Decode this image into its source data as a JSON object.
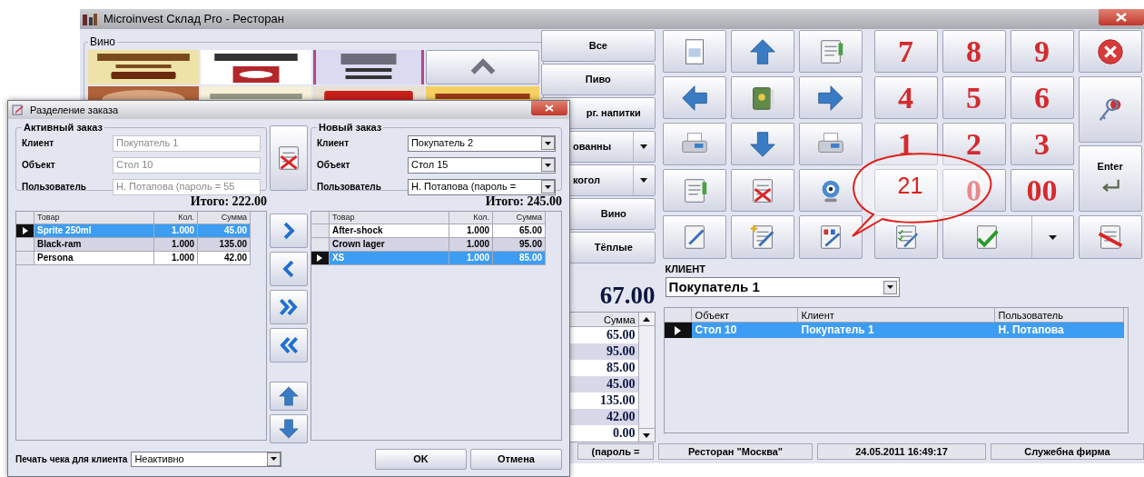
{
  "window": {
    "title": "Microinvest Склад Pro - Ресторан"
  },
  "wine_group": {
    "title": "Вино"
  },
  "categories": [
    {
      "label": "Все",
      "dropdown": false
    },
    {
      "label": "Пиво",
      "dropdown": false
    },
    {
      "label": "рг. напитки",
      "dropdown": false
    },
    {
      "label": "ованны",
      "dropdown": true
    },
    {
      "label": "когол",
      "dropdown": true
    },
    {
      "label": "Вино",
      "dropdown": false
    },
    {
      "label": "Тёплые",
      "dropdown": false
    }
  ],
  "order_total": "67.00",
  "sums": {
    "header": "Сумма",
    "values": [
      "65.00",
      "95.00",
      "85.00",
      "45.00",
      "135.00",
      "42.00",
      "0.00"
    ]
  },
  "keypad": {
    "digits": [
      "7",
      "8",
      "9",
      "4",
      "5",
      "6",
      "1",
      "2",
      "3",
      "0",
      "00"
    ],
    "enter": "Enter"
  },
  "callout": {
    "text": "21"
  },
  "client": {
    "label": "КЛИЕНТ",
    "value": "Покупатель 1"
  },
  "orders_table": {
    "columns": [
      "Объект",
      "Клиент",
      "Пользователь"
    ],
    "rows": [
      {
        "cells": [
          "Стол 10",
          "Покупатель 1",
          "Н. Потапова"
        ],
        "selected": true
      }
    ]
  },
  "status_bar": [
    "(пароль =",
    "Ресторан \"Москва\"",
    "24.05.2011 16:49:17",
    "Служебна фирма"
  ],
  "dialog": {
    "title": "Разделение заказа",
    "active_order": {
      "title": "Активный заказ",
      "fields": [
        {
          "label": "Клиент",
          "value": "Покупатель 1",
          "disabled": true
        },
        {
          "label": "Объект",
          "value": "Стол 10",
          "disabled": true
        },
        {
          "label": "Пользователь",
          "value": "Н. Потапова  (пароль = 55",
          "disabled": true
        }
      ],
      "total": "Итого: 222.00",
      "grid": {
        "columns": [
          "Товар",
          "Кол.",
          "Сумма"
        ],
        "rows": [
          {
            "cells": [
              "Sprite 250ml",
              "1.000",
              "45.00"
            ],
            "selected": true
          },
          {
            "cells": [
              "Black-ram",
              "1.000",
              "135.00"
            ],
            "selected": false
          },
          {
            "cells": [
              "Persona",
              "1.000",
              "42.00"
            ],
            "selected": false
          }
        ]
      }
    },
    "new_order": {
      "title": "Новый заказ",
      "fields": [
        {
          "label": "Клиент",
          "value": "Покупатель 2",
          "disabled": false
        },
        {
          "label": "Объект",
          "value": "Стол 15",
          "disabled": false
        },
        {
          "label": "Пользователь",
          "value": "Н. Потапова  (пароль =",
          "disabled": false
        }
      ],
      "total": "Итого: 245.00",
      "grid": {
        "columns": [
          "Товар",
          "Кол.",
          "Сумма"
        ],
        "rows": [
          {
            "cells": [
              "After-shock",
              "1.000",
              "65.00"
            ],
            "selected": false
          },
          {
            "cells": [
              "Crown lager",
              "1.000",
              "95.00"
            ],
            "selected": false
          },
          {
            "cells": [
              "XS",
              "1.000",
              "85.00"
            ],
            "selected": true
          }
        ]
      }
    },
    "print_label": "Печать чека для клиента",
    "print_value": "Неактивно",
    "buttons": [
      "OK",
      "Отмена"
    ]
  }
}
